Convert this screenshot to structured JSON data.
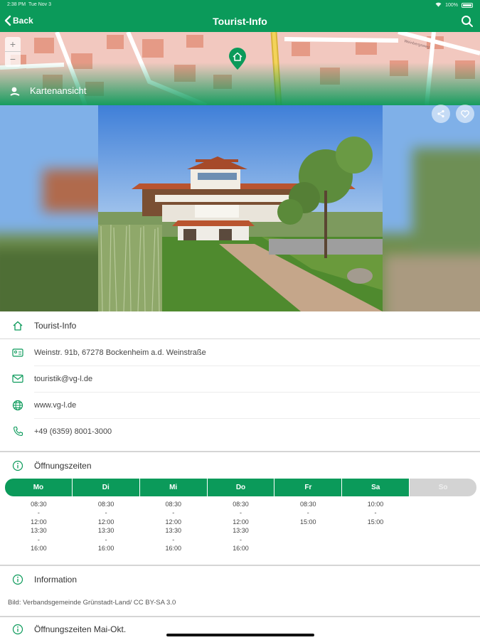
{
  "status_bar": {
    "time": "2:38 PM",
    "date": "Tue Nov 3",
    "battery": "100%"
  },
  "navbar": {
    "back_label": "Back",
    "title": "Tourist-Info"
  },
  "map": {
    "label": "Kartenansicht",
    "zoom_in": "+",
    "zoom_out": "−"
  },
  "colors": {
    "accent": "#0b9a5a",
    "inactive": "#d3d3d3"
  },
  "contact": {
    "name": "Tourist-Info",
    "address": "Weinstr. 91b, 67278 Bockenheim a.d. Weinstraße",
    "email": "touristik@vg-l.de",
    "website": "www.vg-l.de",
    "phone": "+49 (6359) 8001-3000"
  },
  "opening_hours": {
    "title": "Öffnungszeiten",
    "days": [
      {
        "label": "Mo",
        "lines": [
          "08:30",
          "-",
          "12:00",
          "13:30",
          "-",
          "16:00"
        ]
      },
      {
        "label": "Di",
        "lines": [
          "08:30",
          "-",
          "12:00",
          "13:30",
          "-",
          "16:00"
        ]
      },
      {
        "label": "Mi",
        "lines": [
          "08:30",
          "-",
          "12:00",
          "13:30",
          "-",
          "16:00"
        ]
      },
      {
        "label": "Do",
        "lines": [
          "08:30",
          "-",
          "12:00",
          "13:30",
          "-",
          "16:00"
        ]
      },
      {
        "label": "Fr",
        "lines": [
          "08:30",
          "-",
          "15:00"
        ]
      },
      {
        "label": "Sa",
        "lines": [
          "10:00",
          "-",
          "15:00"
        ]
      },
      {
        "label": "So",
        "lines": []
      }
    ]
  },
  "information": {
    "title": "Information",
    "caption": "Bild: Verbandsgemeinde Grünstadt-Land/ CC BY-SA 3.0"
  },
  "seasonal_hours": {
    "title": "Öffnungszeiten Mai-Okt."
  }
}
